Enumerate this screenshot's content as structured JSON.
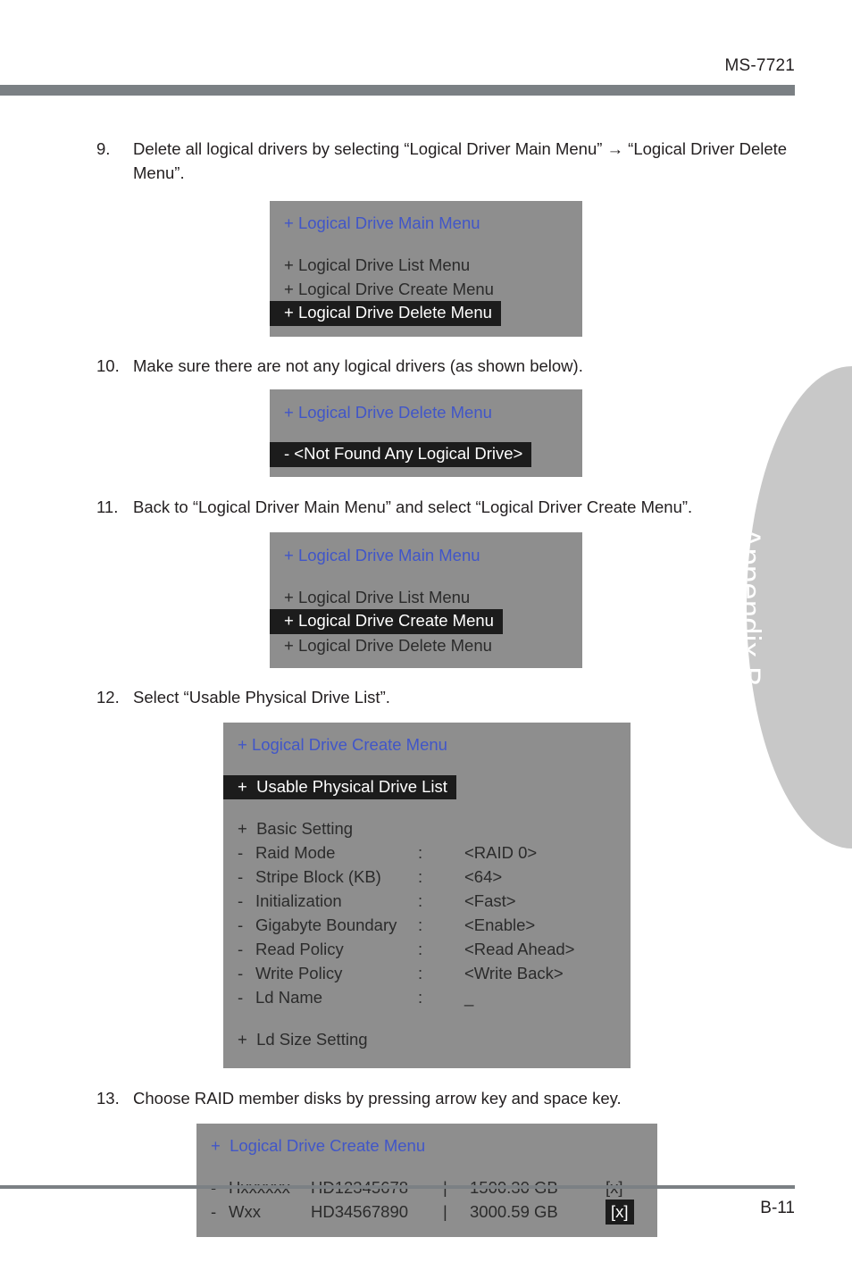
{
  "header": {
    "model": "MS-7721"
  },
  "side_tab": {
    "label": "Appendix B"
  },
  "footer": {
    "page_number": "B-11"
  },
  "colors": {
    "header_bar": "#7b8084",
    "console_bg": "#8e8e8e",
    "console_title": "#4156c8",
    "highlight_bg": "#1c1c1c",
    "highlight_fg": "#ffffff",
    "side_tab_bg": "#c8c8c8",
    "body_text": "#231f20"
  },
  "steps": [
    {
      "number": "9.",
      "text": "Delete all logical drivers by selecting “Logical Driver Main Menu” → “Logical Driver Delete Menu”."
    },
    {
      "number": "10.",
      "text": "Make sure there are not any logical drivers (as shown below)."
    },
    {
      "number": "11.",
      "text": "Back to “Logical Driver Main Menu” and select “Logical Driver Create Menu”."
    },
    {
      "number": "12.",
      "text": "Select “Usable Physical Drive List”."
    },
    {
      "number": "13.",
      "text": "Choose RAID member disks by pressing arrow key and space key."
    }
  ],
  "console_a": {
    "title": "+ Logical Drive Main Menu",
    "items": [
      "+ Logical Drive List Menu",
      "+ Logical Drive Create Menu"
    ],
    "highlighted": "+ Logical Drive Delete Menu"
  },
  "console_b": {
    "title": "+ Logical Drive Delete Menu",
    "highlighted": "- <Not Found Any Logical Drive>"
  },
  "console_c": {
    "title": "+ Logical Drive Main Menu",
    "item_before": "+ Logical Drive List Menu",
    "highlighted": "+ Logical Drive Create Menu",
    "item_after": "+ Logical Drive Delete Menu"
  },
  "console_d": {
    "title": "+ Logical Drive Create Menu",
    "highlighted": "+  Usable Physical Drive List",
    "basic_setting": "+  Basic Setting",
    "settings": [
      {
        "dash": "-",
        "label": "Raid Mode",
        "colon": ":",
        "value": "<RAID 0>"
      },
      {
        "dash": "-",
        "label": "Stripe Block (KB)",
        "colon": ":",
        "value": "<64>"
      },
      {
        "dash": "-",
        "label": "Initialization",
        "colon": ":",
        "value": "<Fast>"
      },
      {
        "dash": "-",
        "label": "Gigabyte Boundary",
        "colon": ":",
        "value": "<Enable>"
      },
      {
        "dash": "-",
        "label": "Read Policy",
        "colon": ":",
        "value": "<Read Ahead>"
      },
      {
        "dash": "-",
        "label": "Write Policy",
        "colon": ":",
        "value": "<Write Back>"
      },
      {
        "dash": "-",
        "label": "Ld Name",
        "colon": ":",
        "value": "_"
      }
    ],
    "ld_size_setting": "+  Ld Size Setting"
  },
  "console_e": {
    "title": "+  Logical Drive Create Menu",
    "drives": [
      {
        "dash": "-",
        "name": "Hxxxxxx",
        "model": "HD12345678",
        "bar": "|",
        "size": "1500.30 GB",
        "mark": "[x]",
        "selected": false
      },
      {
        "dash": "-",
        "name": "Wxx",
        "model": "HD34567890",
        "bar": "|",
        "size": "3000.59 GB",
        "mark": "[x]",
        "selected": true
      }
    ]
  }
}
